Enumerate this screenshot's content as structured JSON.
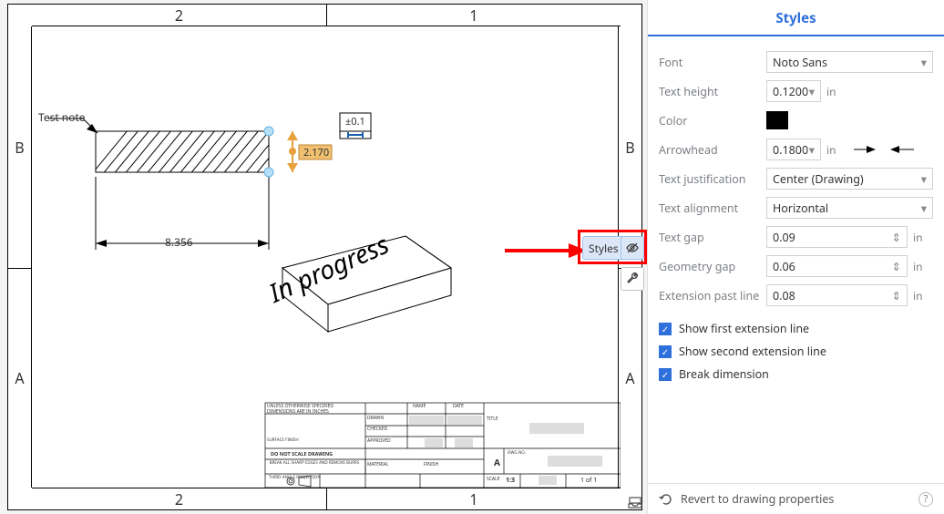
{
  "sheet": {
    "cols": {
      "left": "2",
      "right": "1"
    },
    "rows": {
      "top": "B",
      "bottom": "A"
    },
    "note_text": "Test note",
    "dim_width": "8.356",
    "dim_height": "2.170",
    "tol_text": "±0.1",
    "watermark": "In progress",
    "titleblock": {
      "hdr_spec": "UNLESS OTHERWISE SPECIFIED",
      "hdr_inch": "DIMENSIONS ARE IN INCHES",
      "do_not_scale": "DO NOT SCALE DRAWING",
      "break_edges": "BREAK ALL SHARP EDGES AND REMOVE BURRS",
      "third_angle": "THIRD ANGLE PROJECTION",
      "drawn": "DRAWN",
      "checked": "CHECKED",
      "approved": "APPROVED",
      "name": "NAME",
      "date": "DATE",
      "material": "MATERIAL",
      "finish": "FINISH",
      "surface": "SURFACE FINISH",
      "title": "TITLE",
      "size": "A",
      "scale_lbl": "SCALE",
      "scale": "1:3",
      "sheet": "1 of 1",
      "dwg_no": "DWG NO."
    }
  },
  "callout_label": "Styles",
  "panel": {
    "title": "Styles",
    "font": {
      "label": "Font",
      "value": "Noto Sans"
    },
    "text_height": {
      "label": "Text height",
      "value": "0.1200",
      "unit": "in"
    },
    "color": {
      "label": "Color",
      "value": "#000000"
    },
    "arrowhead": {
      "label": "Arrowhead",
      "value": "0.1800",
      "unit": "in"
    },
    "text_justification": {
      "label": "Text justification",
      "value": "Center (Drawing)"
    },
    "text_alignment": {
      "label": "Text alignment",
      "value": "Horizontal"
    },
    "text_gap": {
      "label": "Text gap",
      "value": "0.09",
      "unit": "in"
    },
    "geometry_gap": {
      "label": "Geometry gap",
      "value": "0.06",
      "unit": "in"
    },
    "extension_past_line": {
      "label": "Extension past line",
      "value": "0.08",
      "unit": "in"
    },
    "checks": {
      "first_ext": "Show first extension line",
      "second_ext": "Show second extension line",
      "break_dim": "Break dimension"
    },
    "footer": "Revert to drawing properties"
  }
}
